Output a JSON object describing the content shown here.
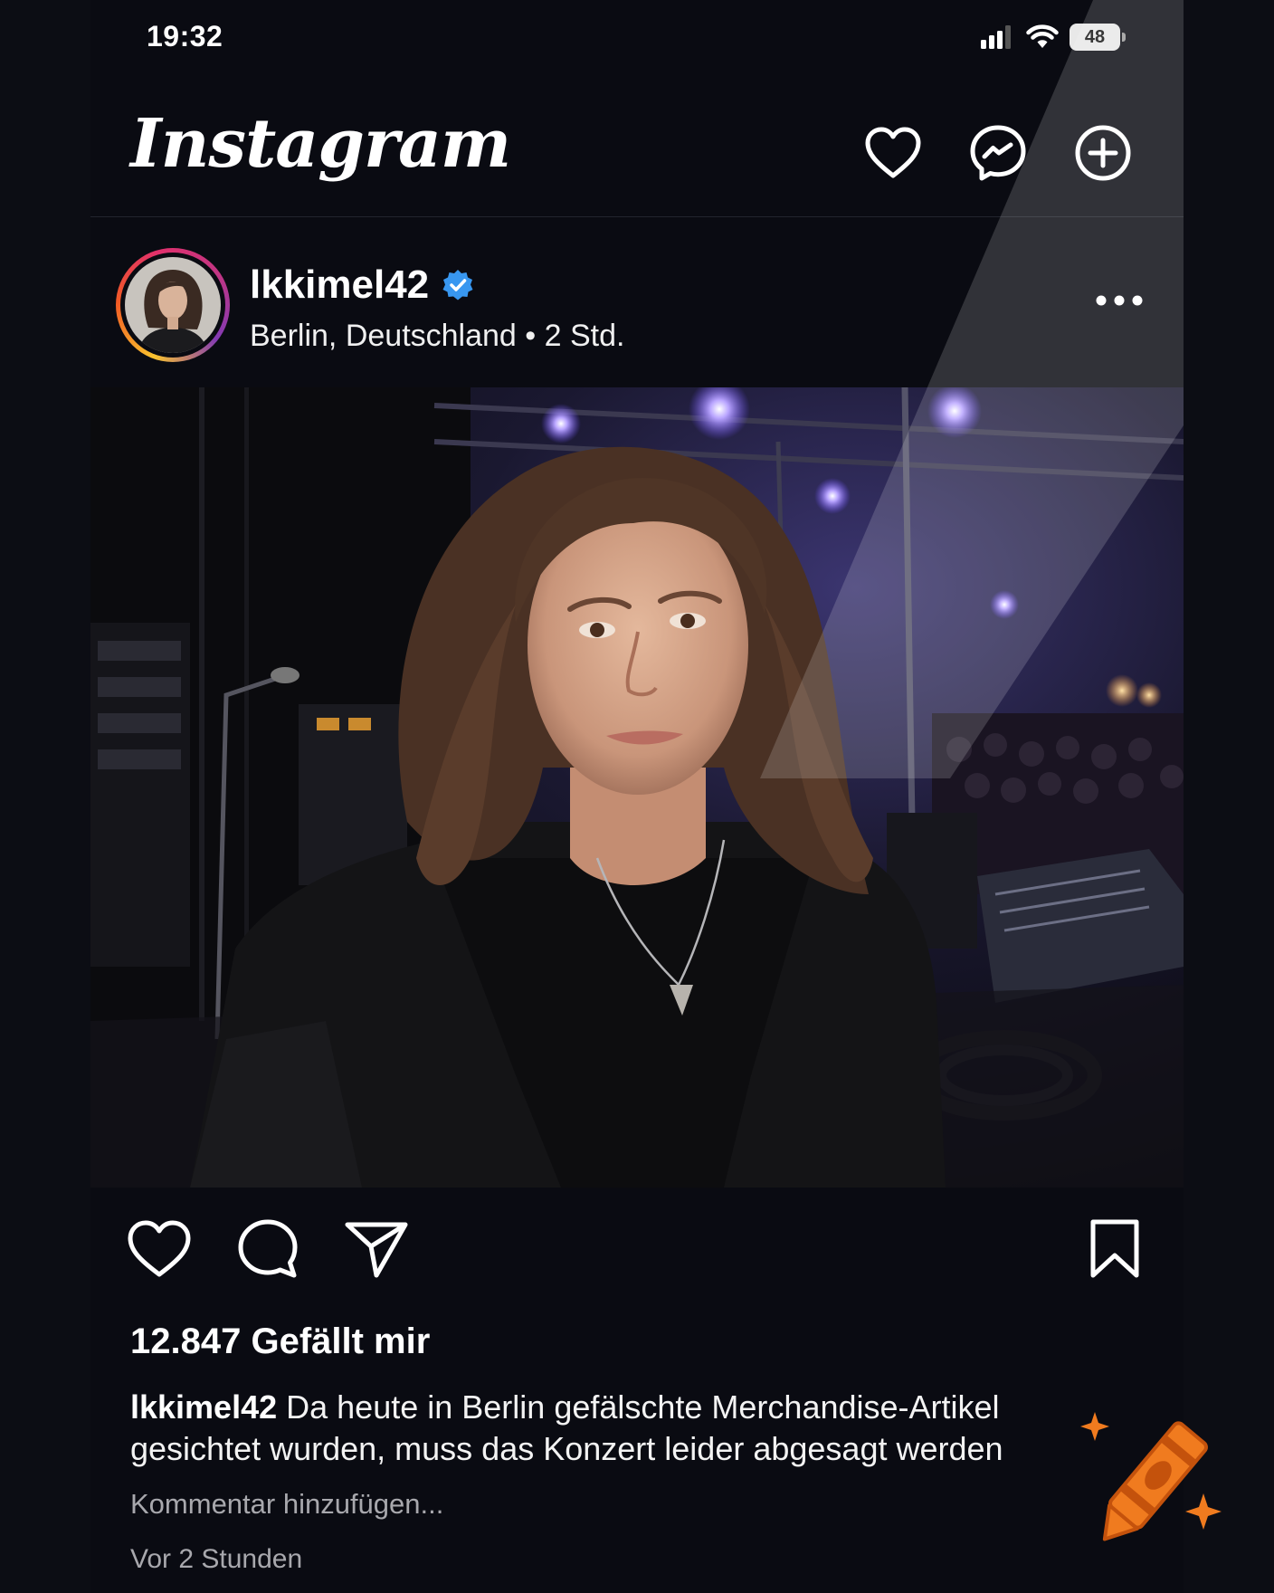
{
  "status_bar": {
    "time": "19:32",
    "battery": "48",
    "icons": [
      "signal-icon",
      "wifi-icon",
      "battery-icon"
    ]
  },
  "header": {
    "logo": "Instagram",
    "icons": [
      "heart-icon",
      "messenger-icon",
      "plus-circle-icon"
    ]
  },
  "post": {
    "username": "lkkimel42",
    "verified": true,
    "location": "Berlin, Deutschland",
    "separator": "•",
    "time_ago": "2 Std.",
    "likes": "12.847 Gefällt mir",
    "caption_user": "lkkimel42",
    "caption_text": "Da heute in Berlin gefälschte Merchandise-Artikel gesichtet wurden, muss das Konzert leider abgesagt werden",
    "comment_placeholder": "Kommentar hinzufügen...",
    "timestamp": "Vor 2 Stunden",
    "action_icons": [
      "heart-icon",
      "comment-icon",
      "send-icon",
      "bookmark-icon"
    ]
  },
  "colors": {
    "background": "#0a0b12",
    "text": "#ffffff",
    "muted_text": "#a8a8ad",
    "verified_badge": "#3897f0",
    "crayon_accent": "#f07b1f"
  }
}
